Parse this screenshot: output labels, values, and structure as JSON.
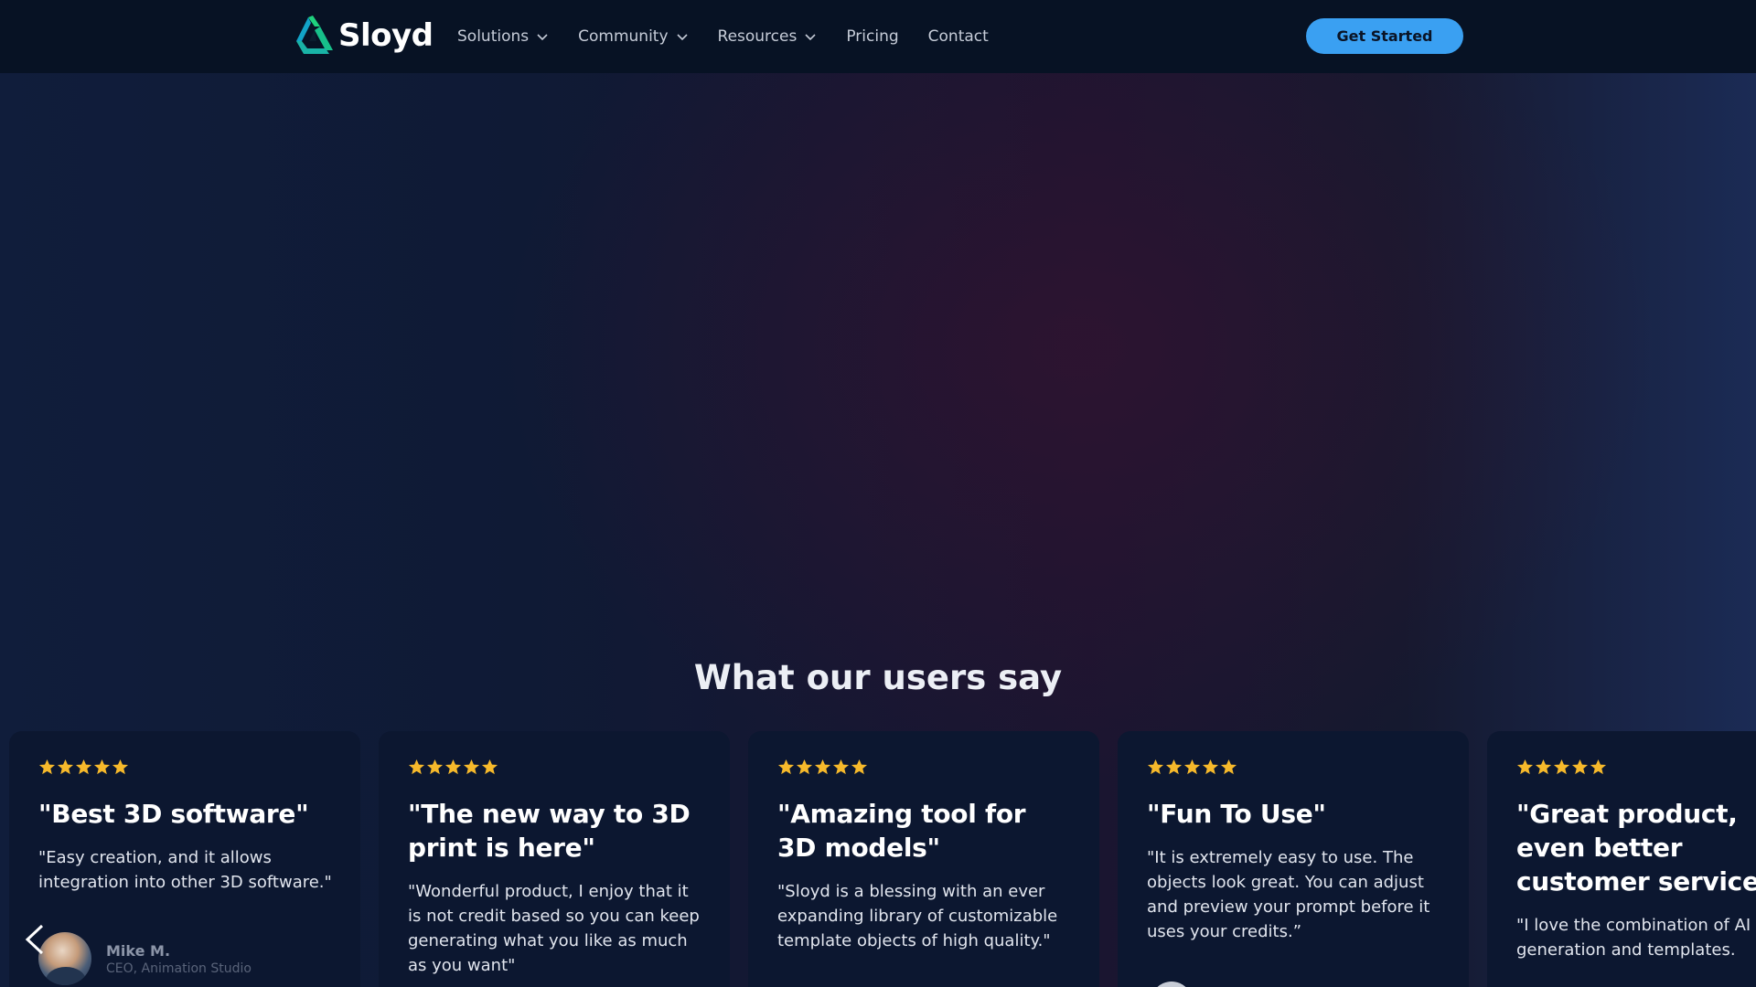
{
  "brand": {
    "name": "Sloyd",
    "logo_colors": [
      "#1fd17e",
      "#12a3c8"
    ]
  },
  "nav": {
    "items": [
      {
        "label": "Solutions",
        "has_dropdown": true
      },
      {
        "label": "Community",
        "has_dropdown": true
      },
      {
        "label": "Resources",
        "has_dropdown": true
      },
      {
        "label": "Pricing",
        "has_dropdown": false
      },
      {
        "label": "Contact",
        "has_dropdown": false
      }
    ],
    "cta_label": "Get Started",
    "cta_color": "#3aa0f2"
  },
  "testimonials": {
    "title": "What our users say",
    "star_color": "#f6b92b",
    "cards": [
      {
        "rating": 5,
        "title": "\"Best 3D software\"",
        "quote": "\"Easy creation, and it allows integration into other 3D software.\"",
        "reviewer_name": "Mike M.",
        "reviewer_role": "CEO, Animation Studio"
      },
      {
        "rating": 5,
        "title": "\"The new way to 3D print is here\"",
        "quote": "\"Wonderful product, I enjoy that it is not credit based so you can keep generating what you like as much as you want\""
      },
      {
        "rating": 5,
        "title": "\"Amazing tool for 3D models\"",
        "quote": "\"Sloyd is a blessing with an ever expanding library of customizable template objects of high quality.\""
      },
      {
        "rating": 5,
        "title": "\"Fun To Use\"",
        "quote": "\"It is extremely easy to use. The objects look great. You can adjust and preview your prompt before it uses your credits.”"
      },
      {
        "rating": 5,
        "title": "\"Great product, even better customer service\"",
        "quote": "\"I love the combination of AI generation and templates."
      }
    ]
  },
  "icons": {
    "prev": "chevron-left-icon",
    "star": "star-icon",
    "dropdown": "chevron-down-icon"
  }
}
